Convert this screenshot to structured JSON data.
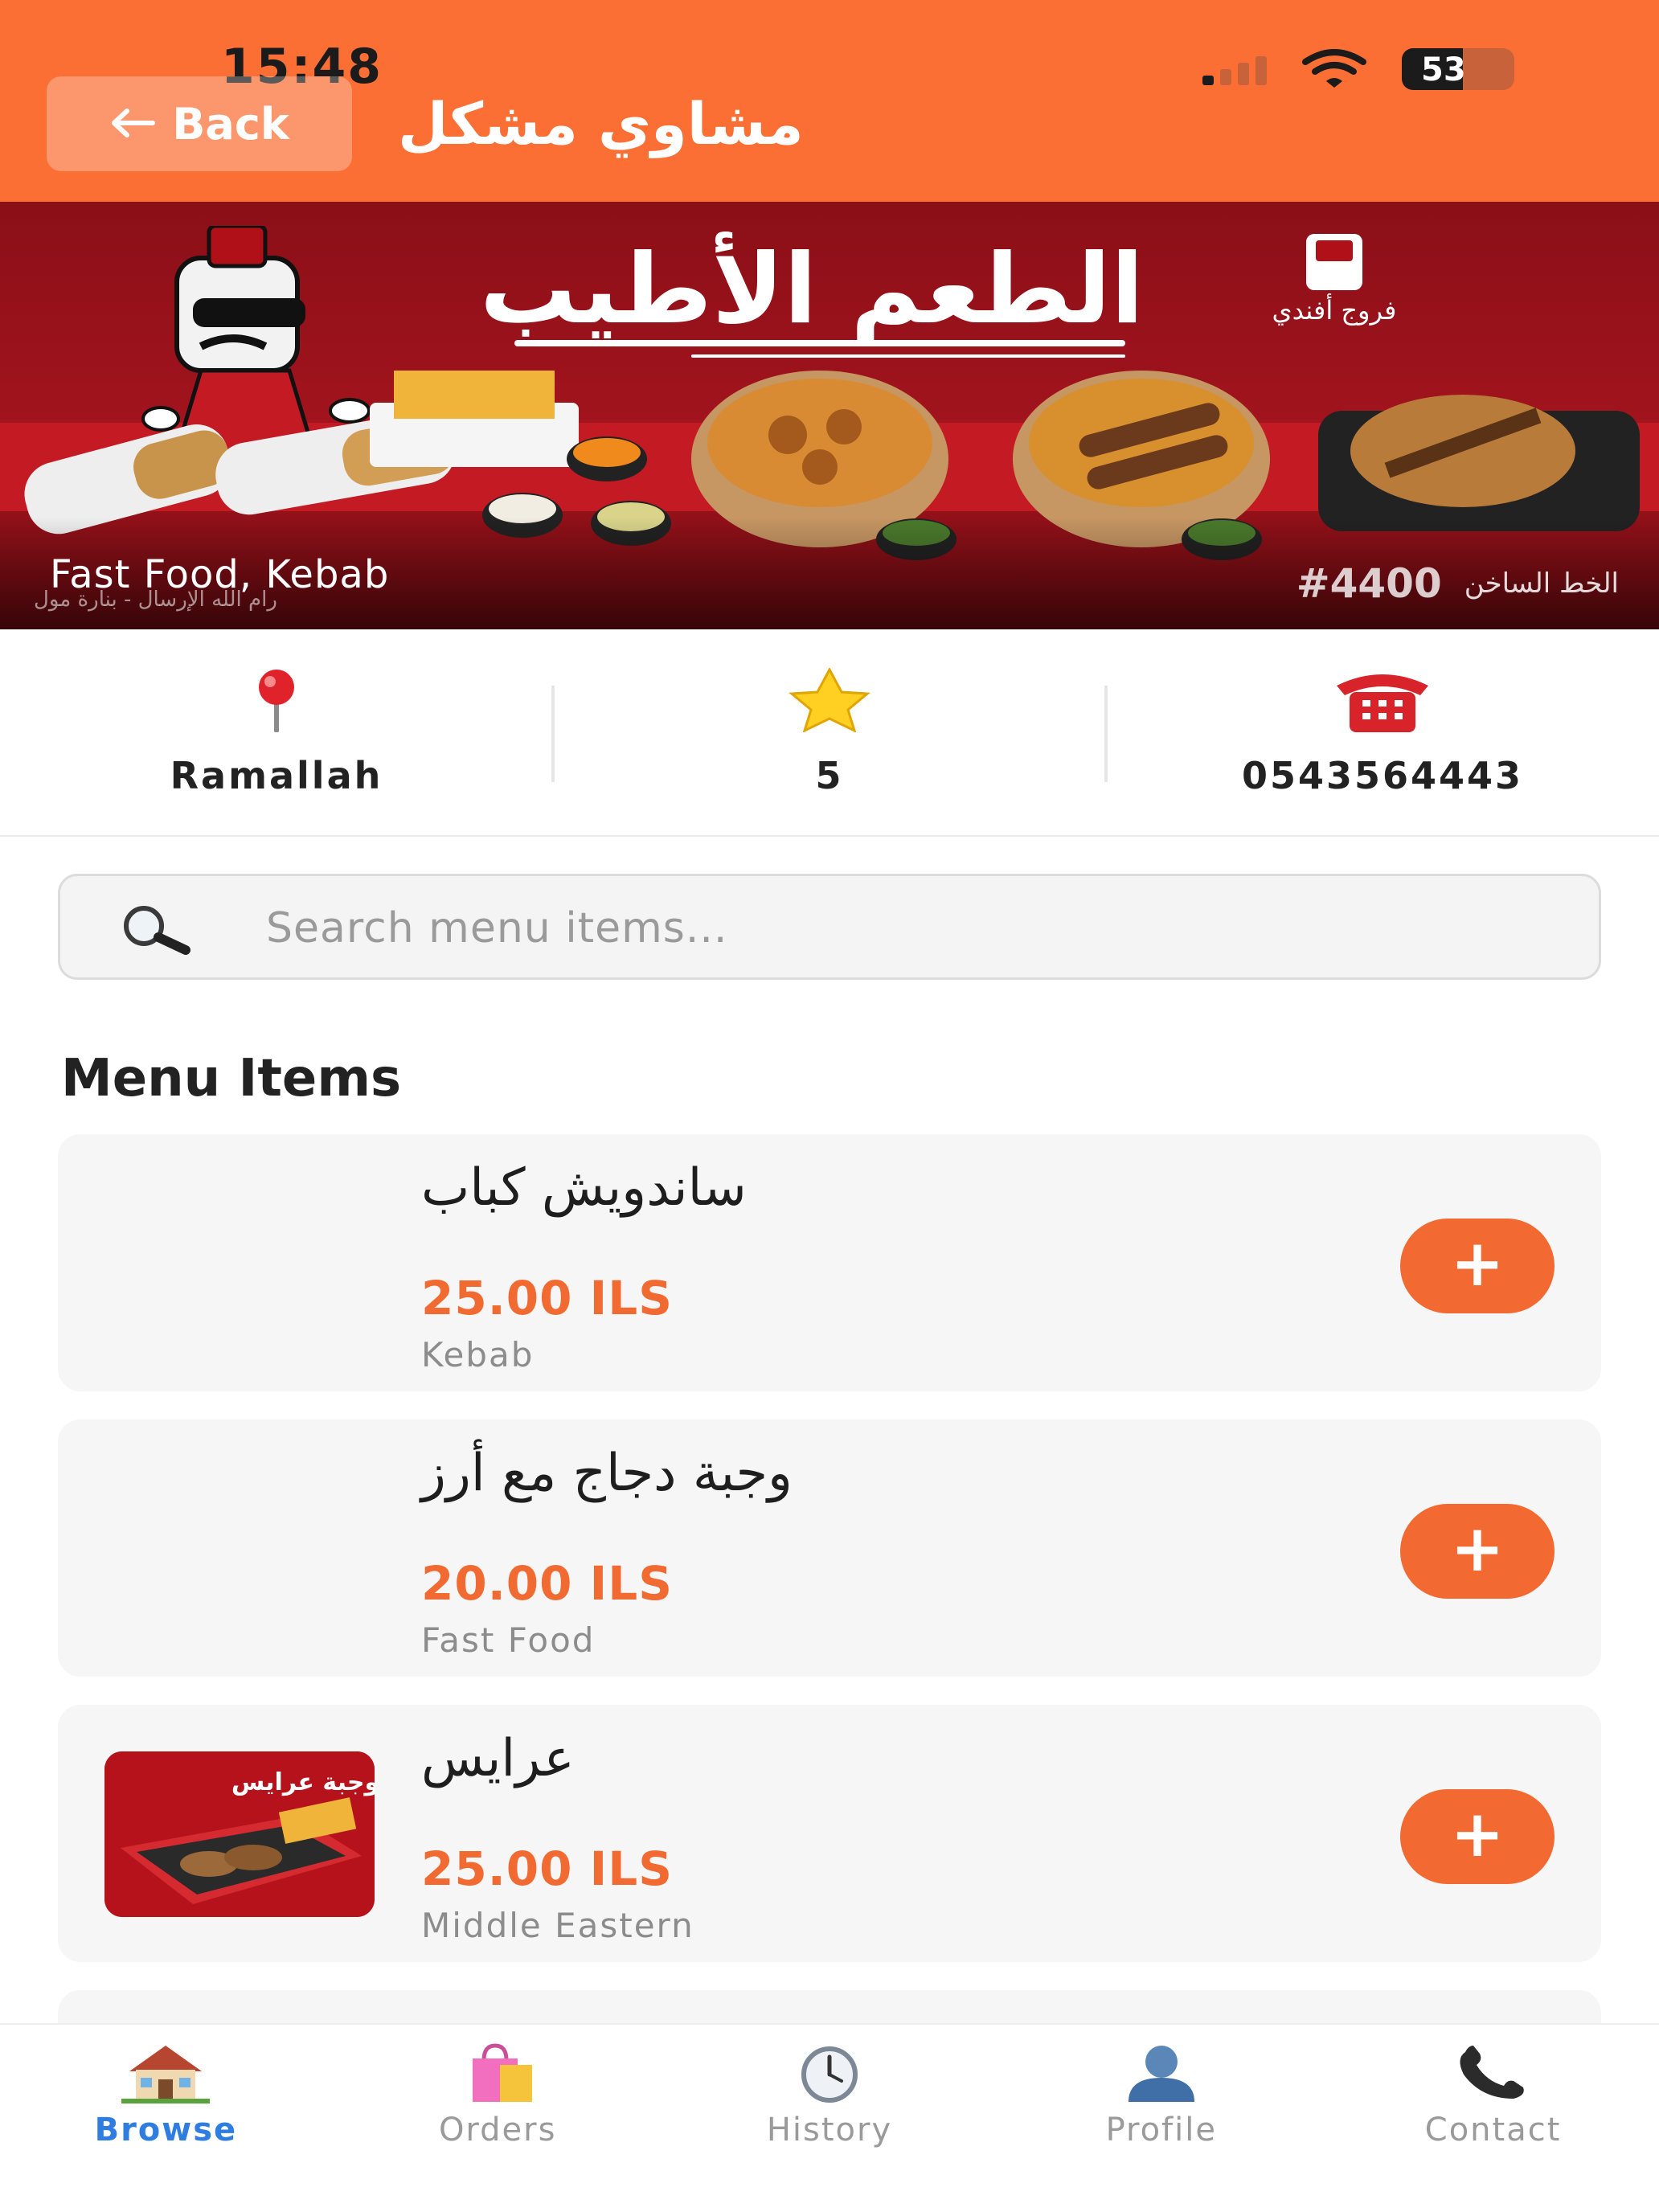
{
  "status_bar": {
    "time": "15:48",
    "battery": "53"
  },
  "header": {
    "back_label": "Back",
    "title": "مشاوي مشكل"
  },
  "banner": {
    "headline": "الطعم الأطيب",
    "brand_name": "فروج أفندي",
    "hotline_label": "الخط الساخن",
    "hotline_number": "#4400",
    "categories": "Fast Food, Kebab",
    "address": "رام الله الإرسال - بنارة مول"
  },
  "info": {
    "location": "Ramallah",
    "rating": "5",
    "phone": "0543564443"
  },
  "search": {
    "placeholder": "Search menu items..."
  },
  "menu": {
    "title": "Menu Items",
    "add_label": "+",
    "items": [
      {
        "name": "ساندويش كباب",
        "price": "25.00 ILS",
        "category": "Kebab",
        "has_image": false
      },
      {
        "name": "وجبة دجاج مع أرز",
        "price": "20.00 ILS",
        "category": "Fast Food",
        "has_image": false
      },
      {
        "name": "عرايس",
        "price": "25.00 ILS",
        "category": "Middle Eastern",
        "has_image": true,
        "image_text": "وجبة عرايس"
      }
    ]
  },
  "nav": {
    "items": [
      {
        "label": "Browse",
        "icon": "house-icon",
        "active": true
      },
      {
        "label": "Orders",
        "icon": "shopping-bag-icon",
        "active": false
      },
      {
        "label": "History",
        "icon": "clock-icon",
        "active": false
      },
      {
        "label": "Profile",
        "icon": "person-icon",
        "active": false
      },
      {
        "label": "Contact",
        "icon": "phone-icon",
        "active": false
      }
    ]
  },
  "colors": {
    "header": "#fb6f35",
    "accent": "#f26a32",
    "nav_active": "#2f7de1",
    "banner": "#a3141e"
  }
}
